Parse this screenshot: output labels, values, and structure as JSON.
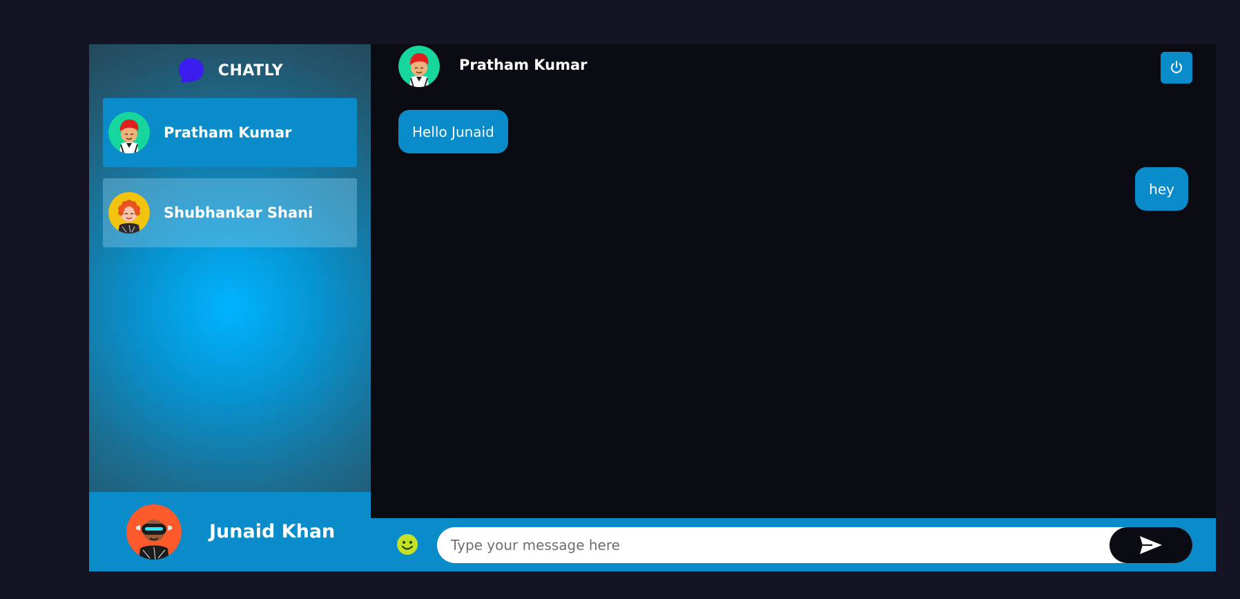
{
  "brand": {
    "name": "CHATLY",
    "logo_icon": "chat-bubble-icon",
    "logo_color": "#3b1df0"
  },
  "sidebar": {
    "contacts": [
      {
        "name": "Pratham Kumar",
        "avatar": "avatar-red-hair-boy",
        "active": true
      },
      {
        "name": "Shubhankar Shani",
        "avatar": "avatar-curly-hair-boy",
        "active": false
      }
    ]
  },
  "current_user": {
    "name": "Junaid Khan",
    "avatar": "avatar-vr-headset"
  },
  "chat": {
    "header": {
      "name": "Pratham Kumar",
      "avatar": "avatar-red-hair-boy",
      "power_icon": "power-icon"
    },
    "messages": [
      {
        "direction": "incoming",
        "text": "Hello Junaid"
      },
      {
        "direction": "outgoing",
        "text": "hey"
      }
    ],
    "composer": {
      "placeholder": "Type your message here",
      "value": "",
      "emoji_icon": "smiley-icon",
      "send_icon": "send-icon"
    }
  },
  "colors": {
    "accent": "#0a8ccb",
    "background": "#141424",
    "chat_background": "#0b0b14",
    "emoji": "#c6e227"
  }
}
